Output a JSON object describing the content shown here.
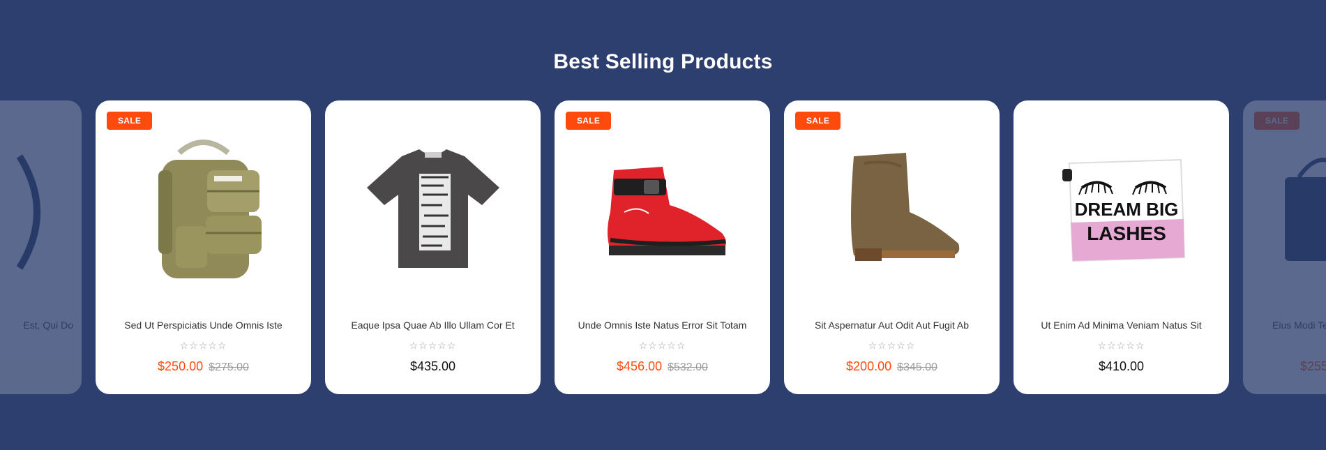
{
  "section": {
    "title": "Best Selling Products"
  },
  "colors": {
    "background": "#2d3f6e",
    "card": "#ffffff",
    "accent": "#ff4a0e",
    "muted": "#9a9a9a"
  },
  "products": [
    {
      "title": "Est, Qui Do",
      "rating": "☆☆☆☆☆",
      "price": "",
      "old_price": "",
      "badge": "",
      "image": "bag-partial",
      "state": "faded-partial"
    },
    {
      "title": "Sed Ut Perspiciatis Unde Omnis Iste",
      "rating": "☆☆☆☆☆",
      "price": "$250.00",
      "old_price": "$275.00",
      "badge": "SALE",
      "image": "backpack"
    },
    {
      "title": "Eaque Ipsa Quae Ab Illo Ullam Cor Et",
      "rating": "☆☆☆☆☆",
      "price": "$435.00",
      "old_price": "",
      "badge": "",
      "image": "tshirt"
    },
    {
      "title": "Unde Omnis Iste Natus Error Sit Totam",
      "rating": "☆☆☆☆☆",
      "price": "$456.00",
      "old_price": "$532.00",
      "badge": "SALE",
      "image": "red-sneaker"
    },
    {
      "title": "Sit Aspernatur Aut Odit Aut Fugit Ab",
      "rating": "☆☆☆☆☆",
      "price": "$200.00",
      "old_price": "$345.00",
      "badge": "SALE",
      "image": "suede-boot"
    },
    {
      "title": "Ut Enim Ad Minima Veniam Natus Sit",
      "rating": "☆☆☆☆☆",
      "price": "$410.00",
      "old_price": "",
      "badge": "",
      "image": "cosmetic-bag",
      "image_text": [
        "DREAM BIG",
        "LASHES"
      ]
    },
    {
      "title": "Eius Modi Te",
      "rating": "",
      "price": "$255",
      "old_price": "",
      "badge": "SALE",
      "image": "tote-bag-partial",
      "state": "faded-partial"
    }
  ]
}
